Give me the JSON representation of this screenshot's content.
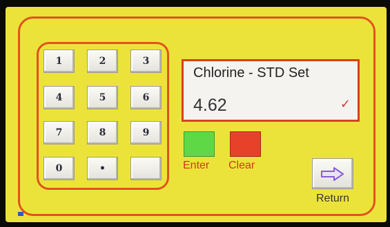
{
  "keypad": {
    "keys": [
      "1",
      "2",
      "3",
      "4",
      "5",
      "6",
      "7",
      "8",
      "9",
      "0",
      "•",
      ""
    ]
  },
  "display": {
    "title": "Chlorine - STD Set",
    "value": "4.62",
    "check_glyph": "✓"
  },
  "actions": {
    "enter_label": "Enter",
    "clear_label": "Clear",
    "return_label": "Return"
  },
  "colors": {
    "screen_bg": "#ece33a",
    "frame": "#e0521e",
    "enter": "#5fd845",
    "clear": "#e8412a",
    "return_arrow": "#8a5ad8"
  },
  "icons": {
    "return": "arrow-right-icon",
    "check": "check-icon"
  }
}
